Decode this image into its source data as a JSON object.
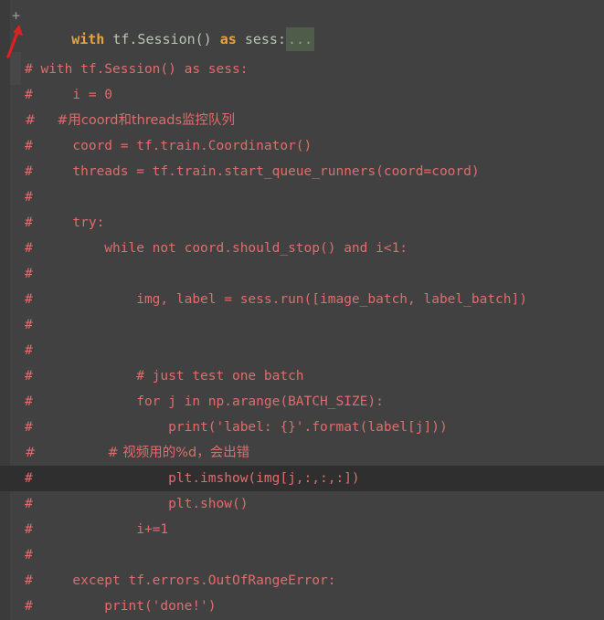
{
  "editor": {
    "background_color": "#414141",
    "gutter_color": "#3b3b3b",
    "comment_color": "#e06c6c",
    "keyword_color": "#e8a33d",
    "plain_color": "#b9c4b2",
    "fold_placeholder_bg": "#4f5c4a",
    "current_line_bg": "#2f2f2f",
    "annotation_arrow_color": "#e02020"
  },
  "fold_line": {
    "fold_marker": "+",
    "tokens": [
      {
        "text": "with",
        "kind": "keyword"
      },
      {
        "text": " tf.Session() ",
        "kind": "plain"
      },
      {
        "text": "as",
        "kind": "keyword"
      },
      {
        "text": " sess",
        "kind": "plain"
      },
      {
        "text": ":",
        "kind": "punct"
      }
    ],
    "full_text": "+with tf.Session() as sess:...",
    "fold_placeholder": "..."
  },
  "annotation": {
    "type": "arrow",
    "points_to": "fold-marker-plus",
    "color": "#e02020"
  },
  "code": {
    "lines": [
      {
        "text": "# with tf.Session() as sess:",
        "current": false
      },
      {
        "text": "#     i = 0",
        "current": false
      },
      {
        "text": "#     #用coord和threads监控队列",
        "current": false
      },
      {
        "text": "#     coord = tf.train.Coordinator()",
        "current": false
      },
      {
        "text": "#     threads = tf.train.start_queue_runners(coord=coord)",
        "current": false
      },
      {
        "text": "#",
        "current": false
      },
      {
        "text": "#     try:",
        "current": false
      },
      {
        "text": "#         while not coord.should_stop() and i<1:",
        "current": false
      },
      {
        "text": "#",
        "current": false
      },
      {
        "text": "#             img, label = sess.run([image_batch, label_batch])",
        "current": false
      },
      {
        "text": "#",
        "current": false
      },
      {
        "text": "#",
        "current": false
      },
      {
        "text": "#             # just test one batch",
        "current": false
      },
      {
        "text": "#             for j in np.arange(BATCH_SIZE):",
        "current": false
      },
      {
        "text": "#                 print('label: {}'.format(label[j]))",
        "current": false
      },
      {
        "text": "#                 # 视频用的%d，会出错",
        "current": false
      },
      {
        "text": "#                 plt.imshow(img[j,:,:,:])",
        "current": true
      },
      {
        "text": "#                 plt.show()",
        "current": false
      },
      {
        "text": "#             i+=1",
        "current": false
      },
      {
        "text": "#",
        "current": false
      },
      {
        "text": "#     except tf.errors.OutOfRangeError:",
        "current": false
      },
      {
        "text": "#         print('done!')",
        "current": false
      }
    ]
  }
}
